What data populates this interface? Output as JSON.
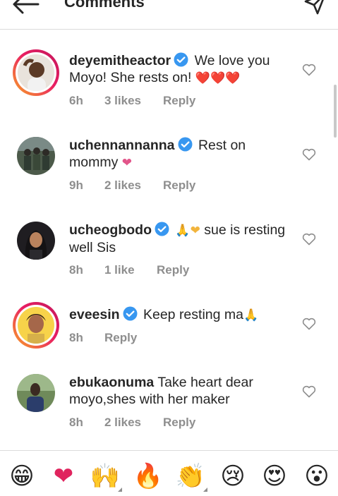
{
  "header": {
    "title": "Comments",
    "back_icon": "arrow-left-icon",
    "send_icon": "send-icon"
  },
  "comments": [
    {
      "username": "deyemitheactor",
      "verified": true,
      "text": "We love you Moyo! She rests on!",
      "emojis": "❤️❤️❤️",
      "time": "6h",
      "likes": "3 likes",
      "reply": "Reply",
      "story_ring": true
    },
    {
      "username": "uchennannanna",
      "verified": true,
      "text": "Rest on mommy",
      "emojis": "❤",
      "time": "9h",
      "likes": "2 likes",
      "reply": "Reply",
      "story_ring": false
    },
    {
      "username": "ucheogbodo",
      "verified": true,
      "emojis_before": "🙏❤",
      "text": "sue is resting well Sis",
      "time": "8h",
      "likes": "1 like",
      "reply": "Reply",
      "story_ring": false
    },
    {
      "username": "eveesin",
      "verified": true,
      "text": "Keep resting ma",
      "emojis": "🙏",
      "time": "8h",
      "likes": "",
      "reply": "Reply",
      "story_ring": true
    },
    {
      "username": "ebukaonuma",
      "verified": false,
      "text": "Take heart dear moyo,shes with her maker",
      "time": "8h",
      "likes": "2 likes",
      "reply": "Reply",
      "story_ring": false
    }
  ],
  "emoji_bar": [
    {
      "glyph": "😁",
      "name": "grinning-face-emoji",
      "has_variants": false
    },
    {
      "glyph": "❤",
      "name": "heart-emoji",
      "has_variants": false
    },
    {
      "glyph": "🙌",
      "name": "raising-hands-emoji",
      "has_variants": true
    },
    {
      "glyph": "🔥",
      "name": "fire-emoji",
      "has_variants": false
    },
    {
      "glyph": "👏",
      "name": "clapping-hands-emoji",
      "has_variants": true
    },
    {
      "glyph": "😢",
      "name": "crying-face-emoji",
      "has_variants": false
    },
    {
      "glyph": "😍",
      "name": "heart-eyes-emoji",
      "has_variants": false
    },
    {
      "glyph": "😮",
      "name": "surprised-face-emoji",
      "has_variants": false
    }
  ],
  "colors": {
    "text": "#262626",
    "meta": "#8e8e8e",
    "verified": "#3897f0",
    "story_ring_start": "#f9a825",
    "story_ring_end": "#c2185b",
    "heart": "#e0245e"
  }
}
